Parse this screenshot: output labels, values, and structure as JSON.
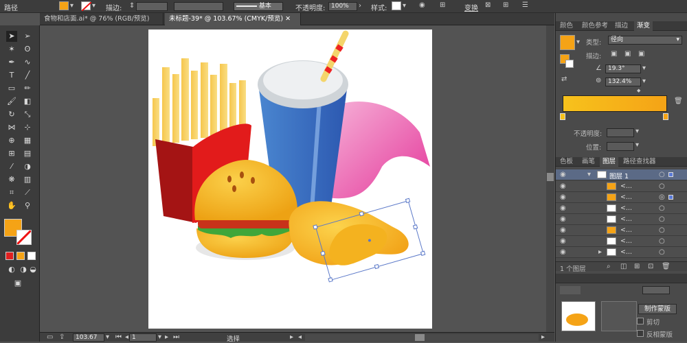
{
  "control_bar": {
    "object_type": "路径",
    "stroke_label": "描边:",
    "stroke_style": "基本",
    "opacity_label": "不透明度:",
    "opacity_value": "100%",
    "style_label": "样式:",
    "transform_label": "变换"
  },
  "document_tabs": [
    {
      "label": "食物和店面.ai* @ 76% (RGB/预览)"
    },
    {
      "label": "未标题-39* @ 103.67% (CMYK/预览)"
    }
  ],
  "status_bar": {
    "zoom": "103.67",
    "page": "1",
    "tool_status": "选择"
  },
  "gradient_panel": {
    "tabs": [
      "颜色",
      "颜色参考",
      "描边",
      "渐变"
    ],
    "active_tab": "渐变",
    "type_label": "类型:",
    "type_value": "径向",
    "stroke_label": "描边:",
    "angle_value": "19.3°",
    "aspect_value": "132.4%",
    "opacity_label": "不透明度:",
    "location_label": "位置:",
    "start_color": "#f7c21c",
    "end_color": "#f5a316"
  },
  "layers_panel": {
    "tabs": [
      "色板",
      "画笔",
      "图层",
      "路径查找器"
    ],
    "active_tab": "图层",
    "layer_name": "图层 1",
    "sublayer_label": "<...",
    "footer_count": "1 个图层"
  },
  "transparency_panel": {
    "mask_button": "制作蒙版",
    "clip_label": "剪切",
    "invert_label": "反相蒙版"
  },
  "colors": {
    "fill": "#f5a316",
    "accent_orange": "#ff9a2a"
  }
}
